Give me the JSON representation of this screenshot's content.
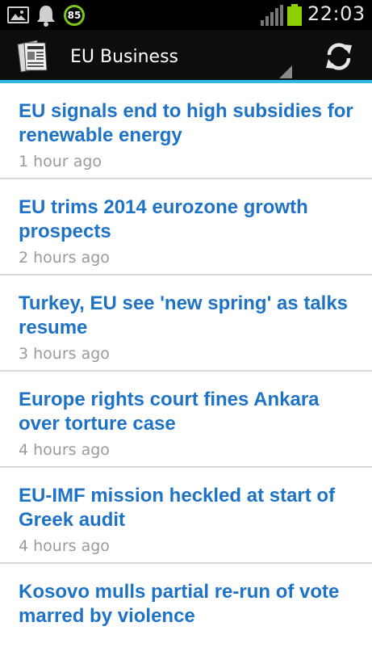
{
  "status_bar": {
    "icons": [
      "gallery-icon",
      "notification-bell-icon",
      "badge-icon",
      "signal-icon",
      "battery-icon"
    ],
    "badge_count": "85",
    "time": "22:03",
    "badge_color": "#7cc618",
    "battery_color": "#8ed000"
  },
  "action_bar": {
    "title": "EU Business",
    "icons": [
      "newspaper-app-icon",
      "refresh-icon"
    ],
    "accent_color": "#33b5e5"
  },
  "news": [
    {
      "headline": "EU signals end to high subsidies for renewable energy",
      "time": "1 hour ago"
    },
    {
      "headline": "EU trims 2014 eurozone growth prospects",
      "time": "2 hours ago"
    },
    {
      "headline": "Turkey, EU see 'new spring' as talks resume",
      "time": "3 hours ago"
    },
    {
      "headline": "Europe rights court fines Ankara over torture case",
      "time": "4 hours ago"
    },
    {
      "headline": "EU-IMF mission heckled at start of Greek audit",
      "time": "4 hours ago"
    },
    {
      "headline": "Kosovo mulls partial re-run of vote marred by violence",
      "time": ""
    }
  ],
  "colors": {
    "headline": "#1e73c7",
    "timestamp": "#9a9a9a",
    "divider": "#d8d8d8"
  }
}
